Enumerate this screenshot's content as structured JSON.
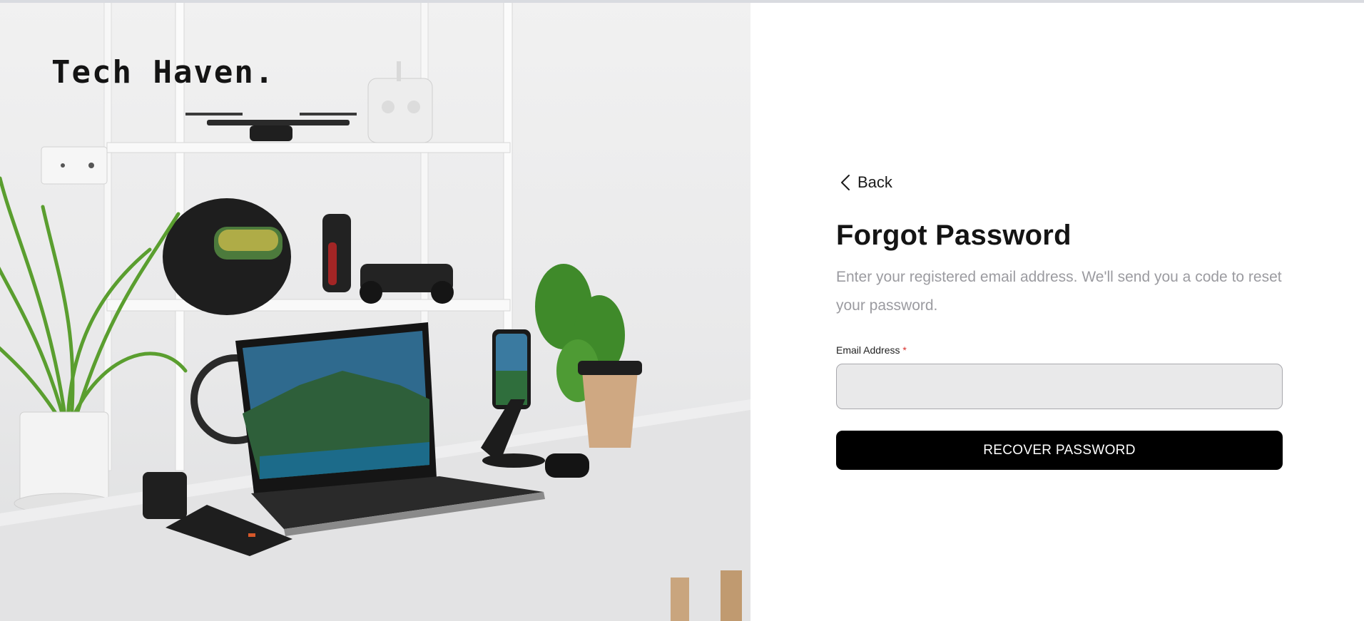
{
  "brand": {
    "name": "Tech Haven."
  },
  "nav": {
    "back_label": "Back",
    "back_icon": "chevron-left-icon"
  },
  "form": {
    "title": "Forgot Password",
    "subtitle": "Enter your registered email address. We'll send you a code to reset your password.",
    "email_label": "Email Address",
    "required_mark": "*",
    "email_value": "",
    "email_placeholder": "",
    "submit_label": "RECOVER PASSWORD"
  },
  "colors": {
    "primary_button": "#000000",
    "input_background": "#e9e9ea",
    "subtitle_text": "#9b9ba0",
    "required_mark": "#d9302c"
  }
}
